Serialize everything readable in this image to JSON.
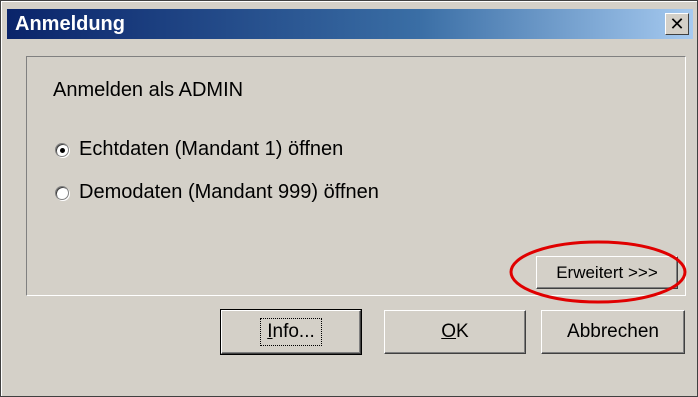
{
  "dialog": {
    "title": "Anmeldung",
    "close_symbol": "✕",
    "heading": "Anmelden als ADMIN",
    "options": [
      {
        "label": "Echtdaten (Mandant 1) öffnen",
        "selected": true
      },
      {
        "label": "Demodaten (Mandant 999) öffnen",
        "selected": false
      }
    ],
    "advanced_label": "Erweitert >>>",
    "buttons": {
      "info_first": "I",
      "info_rest": "nfo...",
      "ok_first": "O",
      "ok_rest": "K",
      "cancel": "Abbrechen"
    }
  },
  "colors": {
    "face": "#d4d0c8",
    "title_start": "#0a246a",
    "title_end": "#a6caf0",
    "annotation": "#e00000"
  },
  "icons": [
    "close-icon",
    "radio-selected-icon",
    "radio-unselected-icon"
  ]
}
